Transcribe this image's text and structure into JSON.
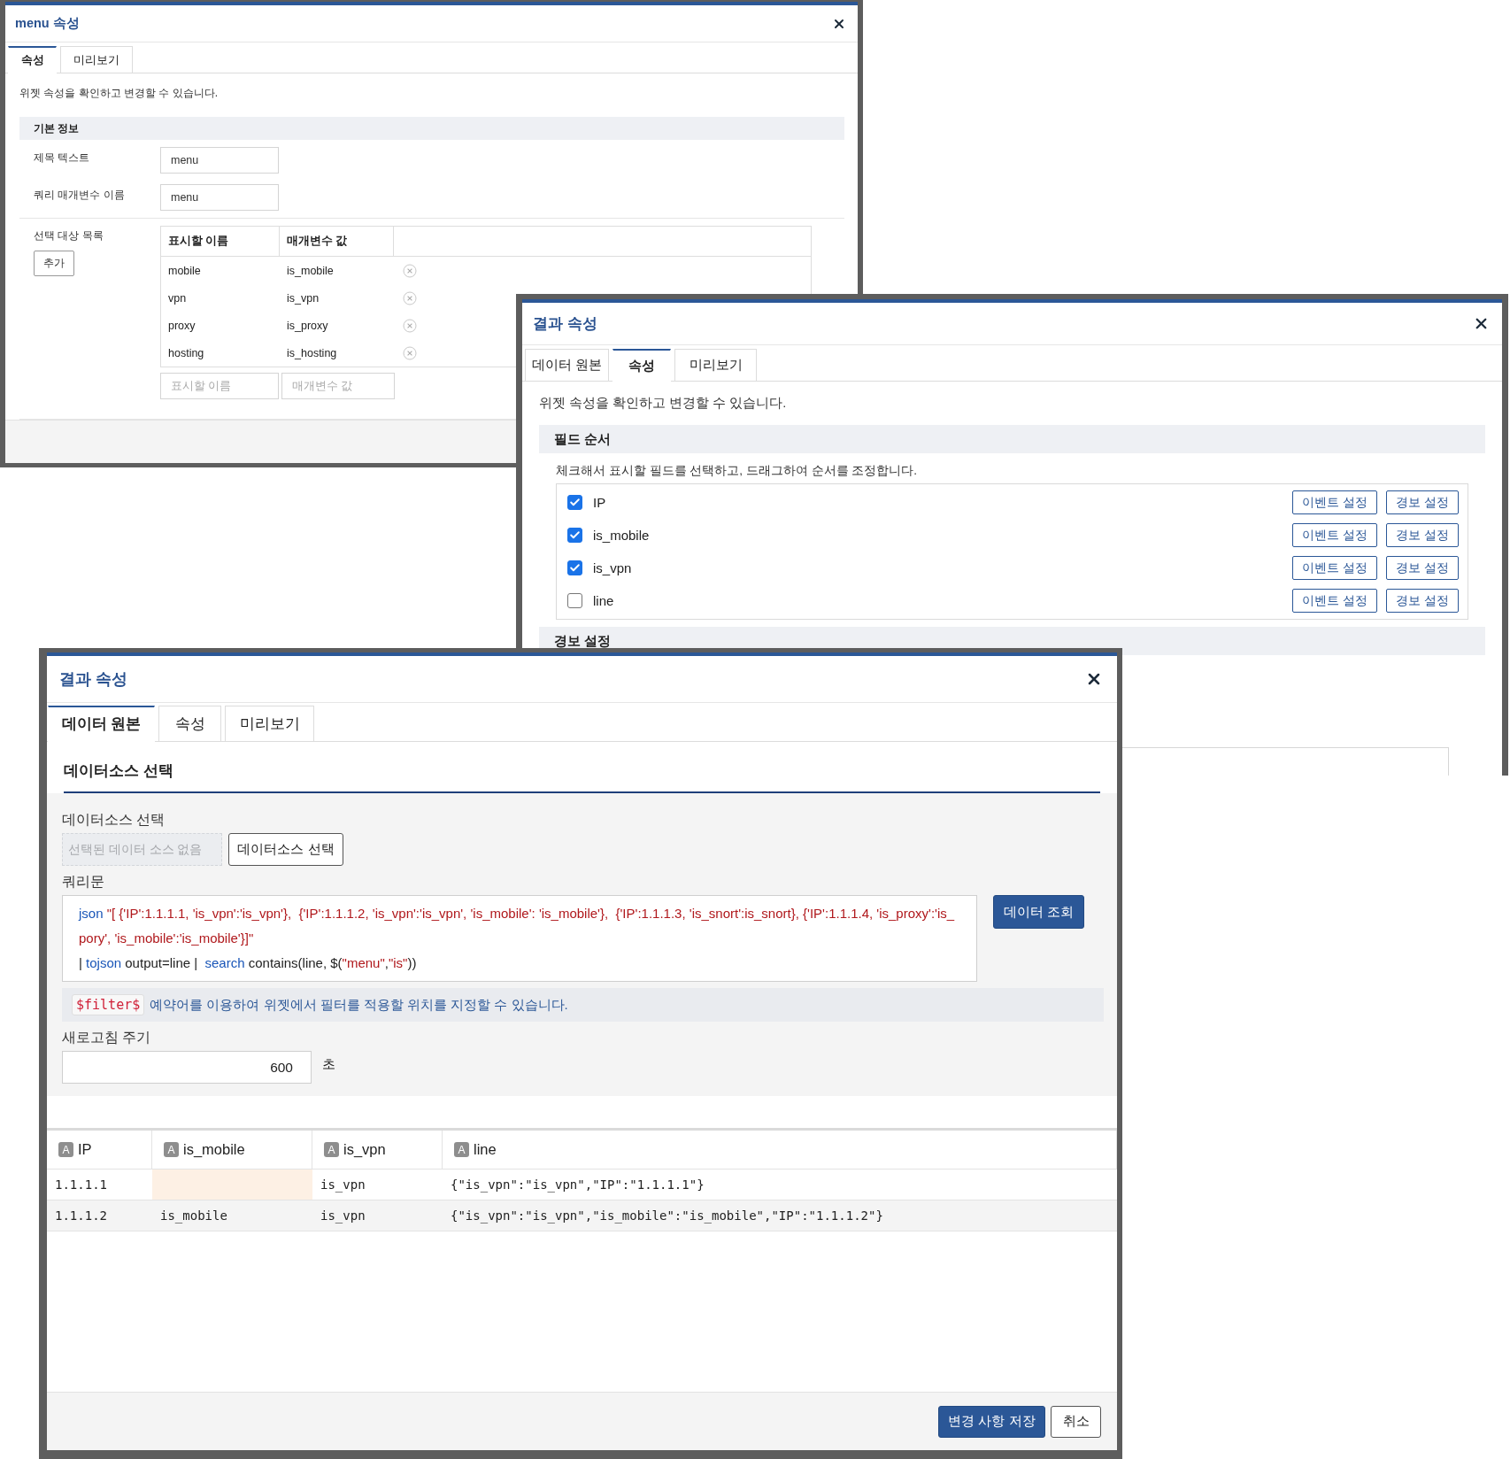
{
  "menu_dialog": {
    "title": "menu 속성",
    "tabs": [
      {
        "label": "속성",
        "selected": true
      },
      {
        "label": "미리보기",
        "selected": false
      }
    ],
    "description": "위젯 속성을 확인하고 변경할 수 있습니다.",
    "section": "기본 정보",
    "fields": [
      {
        "label": "제목 텍스트",
        "value": "menu"
      },
      {
        "label": "쿼리 매개변수 이름",
        "value": "menu"
      }
    ],
    "options": {
      "label": "선택 대상 목록",
      "add_button": "추가",
      "columns": [
        "표시할 이름",
        "매개변수 값"
      ],
      "rows": [
        {
          "name": "mobile",
          "value": "is_mobile"
        },
        {
          "name": "vpn",
          "value": "is_vpn"
        },
        {
          "name": "proxy",
          "value": "is_proxy"
        },
        {
          "name": "hosting",
          "value": "is_hosting"
        }
      ],
      "name_placeholder": "표시할 이름",
      "value_placeholder": "매개변수 값"
    }
  },
  "props_dialog": {
    "title": "결과 속성",
    "tabs": [
      {
        "label": "데이터 원본",
        "selected": false
      },
      {
        "label": "속성",
        "selected": true
      },
      {
        "label": "미리보기",
        "selected": false
      }
    ],
    "description": "위젯 속성을 확인하고 변경할 수 있습니다.",
    "field_order": {
      "section": "필드 순서",
      "help": "체크해서 표시할 필드를 선택하고, 드래그하여 순서를 조정합니다.",
      "fields": [
        {
          "name": "IP",
          "checked": true,
          "event_button": "이벤트 설정",
          "alert_button": "경보 설정"
        },
        {
          "name": "is_mobile",
          "checked": true,
          "event_button": "이벤트 설정",
          "alert_button": "경보 설정"
        },
        {
          "name": "is_vpn",
          "checked": true,
          "event_button": "이벤트 설정",
          "alert_button": "경보 설정"
        },
        {
          "name": "line",
          "checked": false,
          "event_button": "이벤트 설정",
          "alert_button": "경보 설정"
        }
      ]
    },
    "alert_section": "경보 설정"
  },
  "source_dialog": {
    "title": "결과 속성",
    "tabs": [
      {
        "label": "데이터 원본",
        "selected": true
      },
      {
        "label": "속성",
        "selected": false
      },
      {
        "label": "미리보기",
        "selected": false
      }
    ],
    "section": "데이터소스 선택",
    "datasource": {
      "label": "데이터소스 선택",
      "placeholder": "선택된 데이터 소스 없음",
      "button": "데이터소스 선택"
    },
    "query": {
      "label": "쿼리문",
      "button": "데이터 조회",
      "lines": [
        [
          {
            "kind": "keyword",
            "text": "json"
          },
          {
            "kind": "string",
            "text": " \"[ {'IP':1.1.1.1, 'is_vpn':'is_vpn'},  {'IP':1.1.1.2, 'is_vpn':'is_vpn', 'is_mobile': 'is_mobile'},  {'IP':1.1.1.3, 'is_snort':is_snort}, {'IP':1.1.1.4, 'is_proxy':'is_pory', 'is_mobile':'is_mobile'}]\""
          }
        ],
        [
          {
            "kind": "plain",
            "text": "| "
          },
          {
            "kind": "keyword",
            "text": "tojson"
          },
          {
            "kind": "plain",
            "text": " output=line |  "
          },
          {
            "kind": "keyword",
            "text": "search"
          },
          {
            "kind": "plain",
            "text": " contains(line, $("
          },
          {
            "kind": "string",
            "text": "\"menu\""
          },
          {
            "kind": "plain",
            "text": ","
          },
          {
            "kind": "string",
            "text": "\"is\""
          },
          {
            "kind": "plain",
            "text": "))"
          }
        ]
      ]
    },
    "note": {
      "code": "$filter$",
      "text": "예약어를 이용하여 위젯에서 필터를 적용할 위치를 지정할 수 있습니다."
    },
    "refresh": {
      "label": "새로고침 주기",
      "value": "600",
      "unit": "초"
    },
    "table": {
      "columns": [
        {
          "badge": "A",
          "label": "IP"
        },
        {
          "badge": "A",
          "label": "is_mobile"
        },
        {
          "badge": "A",
          "label": "is_vpn"
        },
        {
          "badge": "A",
          "label": "line"
        }
      ],
      "rows": [
        [
          "1.1.1.1",
          null,
          "is_vpn",
          "{\"is_vpn\":\"is_vpn\",\"IP\":\"1.1.1.1\"}"
        ],
        [
          "1.1.1.2",
          "is_mobile",
          "is_vpn",
          "{\"is_vpn\":\"is_vpn\",\"is_mobile\":\"is_mobile\",\"IP\":\"1.1.1.2\"}"
        ]
      ]
    },
    "buttons": {
      "save": "변경 사항 저장",
      "cancel": "취소"
    }
  }
}
